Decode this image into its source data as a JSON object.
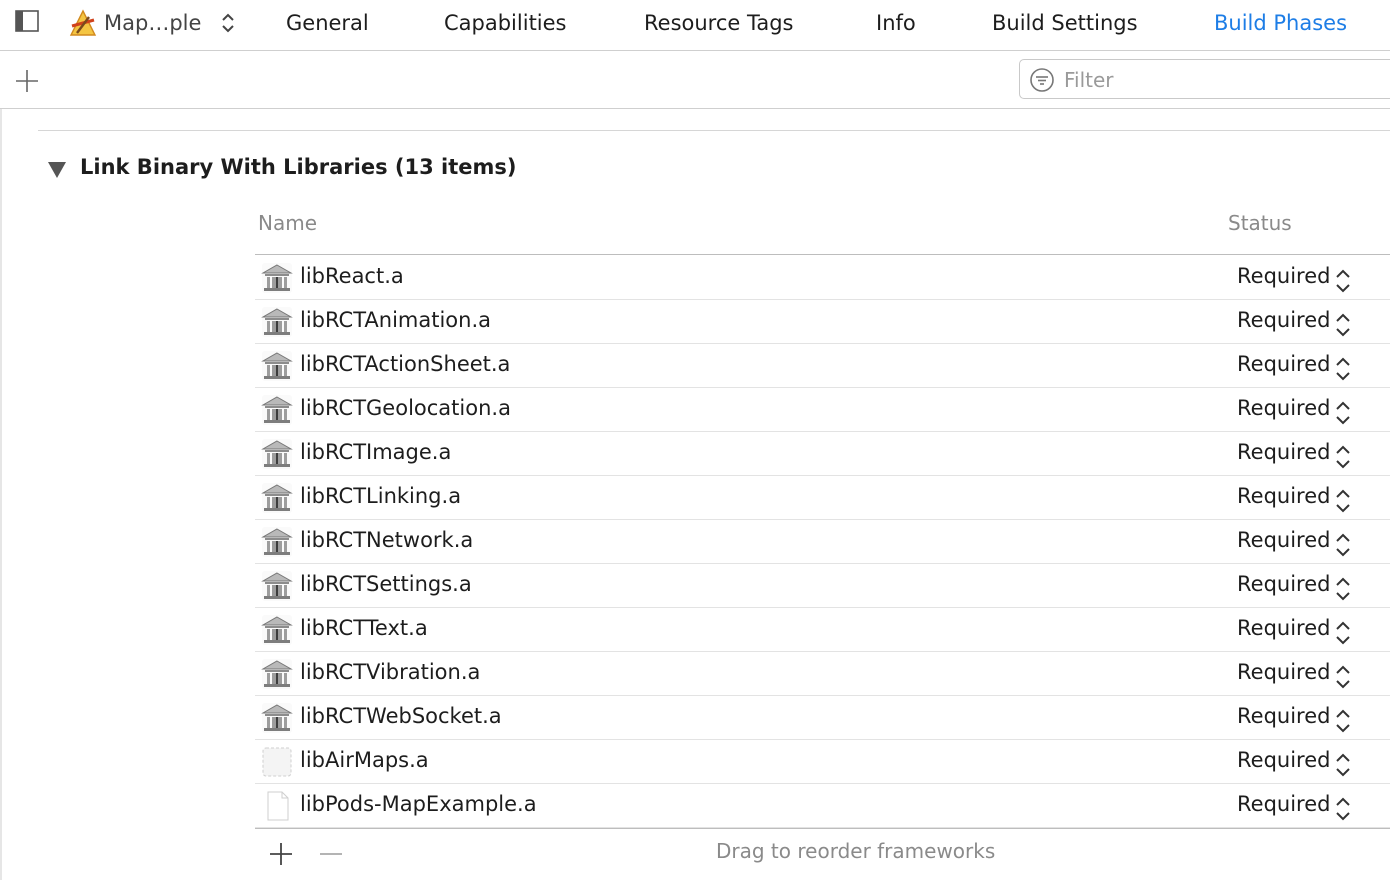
{
  "target": {
    "name": "Map…ple"
  },
  "tabs": [
    {
      "label": "General",
      "selected": false
    },
    {
      "label": "Capabilities",
      "selected": false
    },
    {
      "label": "Resource Tags",
      "selected": false
    },
    {
      "label": "Info",
      "selected": false
    },
    {
      "label": "Build Settings",
      "selected": false
    },
    {
      "label": "Build Phases",
      "selected": true
    }
  ],
  "filter": {
    "placeholder": "Filter",
    "value": ""
  },
  "section": {
    "title": "Link Binary With Libraries (13 items)",
    "columns": {
      "name": "Name",
      "status": "Status"
    },
    "libraries": [
      {
        "name": "libReact.a",
        "status": "Required",
        "icon": "library-icon"
      },
      {
        "name": "libRCTAnimation.a",
        "status": "Required",
        "icon": "library-icon"
      },
      {
        "name": "libRCTActionSheet.a",
        "status": "Required",
        "icon": "library-icon"
      },
      {
        "name": "libRCTGeolocation.a",
        "status": "Required",
        "icon": "library-icon"
      },
      {
        "name": "libRCTImage.a",
        "status": "Required",
        "icon": "library-icon"
      },
      {
        "name": "libRCTLinking.a",
        "status": "Required",
        "icon": "library-icon"
      },
      {
        "name": "libRCTNetwork.a",
        "status": "Required",
        "icon": "library-icon"
      },
      {
        "name": "libRCTSettings.a",
        "status": "Required",
        "icon": "library-icon"
      },
      {
        "name": "libRCTText.a",
        "status": "Required",
        "icon": "library-icon"
      },
      {
        "name": "libRCTVibration.a",
        "status": "Required",
        "icon": "library-icon"
      },
      {
        "name": "libRCTWebSocket.a",
        "status": "Required",
        "icon": "library-icon"
      },
      {
        "name": "libAirMaps.a",
        "status": "Required",
        "icon": "missing-file-icon"
      },
      {
        "name": "libPods-MapExample.a",
        "status": "Required",
        "icon": "blank-file-icon"
      }
    ],
    "drag_hint": "Drag to reorder frameworks"
  },
  "colors": {
    "accent": "#1d7de6",
    "text": "#1d1d1d",
    "secondary_text": "#8a8a8a",
    "divider": "#cfcfcf"
  }
}
